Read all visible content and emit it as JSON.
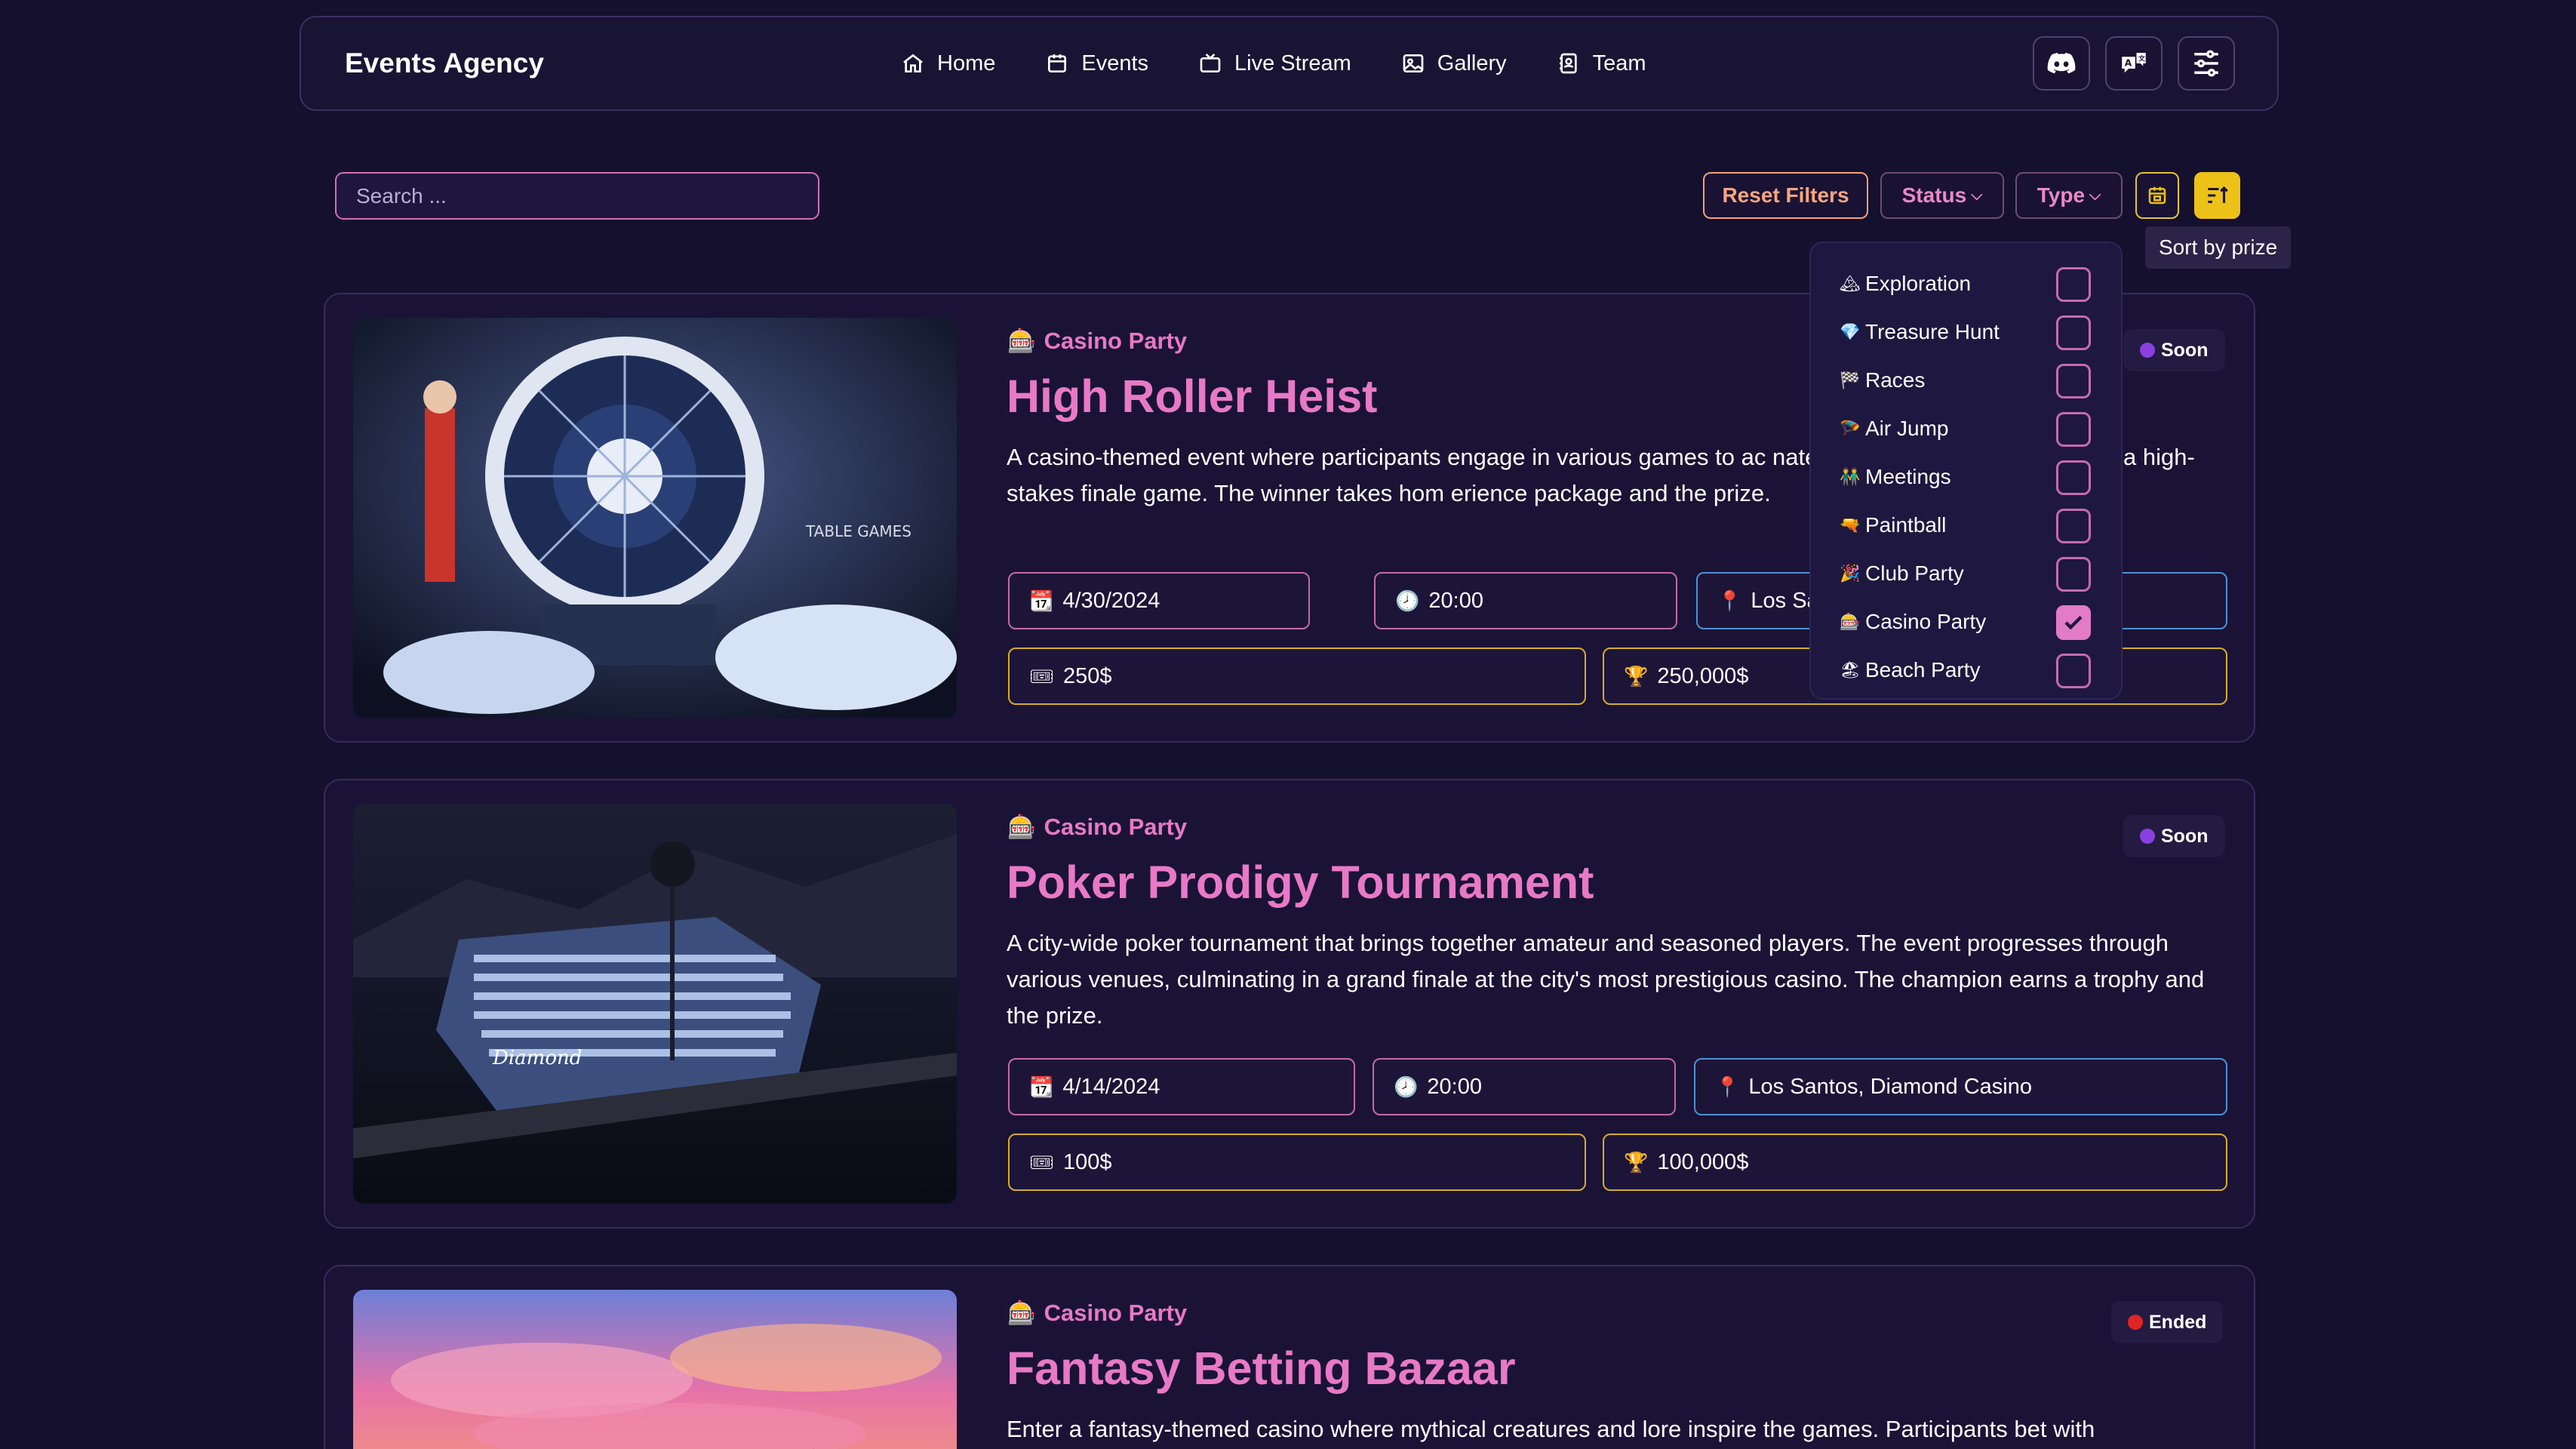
{
  "nav": {
    "brand": "Events Agency",
    "links": [
      {
        "label": "Home",
        "icon": "home-icon"
      },
      {
        "label": "Events",
        "icon": "calendar-icon"
      },
      {
        "label": "Live Stream",
        "icon": "tv-icon"
      },
      {
        "label": "Gallery",
        "icon": "image-icon"
      },
      {
        "label": "Team",
        "icon": "contacts-icon"
      }
    ],
    "icons": [
      "discord-icon",
      "translate-icon",
      "settings-sliders-icon"
    ]
  },
  "toolbar": {
    "search_placeholder": "Search ...",
    "reset_label": "Reset Filters",
    "status_label": "Status",
    "type_label": "Type",
    "sort_tooltip": "Sort by prize"
  },
  "type_filter": {
    "options": [
      {
        "emoji": "🏔",
        "label": "Exploration",
        "checked": false
      },
      {
        "emoji": "💎",
        "label": "Treasure Hunt",
        "checked": false
      },
      {
        "emoji": "🏁",
        "label": "Races",
        "checked": false
      },
      {
        "emoji": "🪂",
        "label": "Air Jump",
        "checked": false
      },
      {
        "emoji": "👬",
        "label": "Meetings",
        "checked": false
      },
      {
        "emoji": "🔫",
        "label": "Paintball",
        "checked": false
      },
      {
        "emoji": "🎉",
        "label": "Club Party",
        "checked": false
      },
      {
        "emoji": "🎰",
        "label": "Casino Party",
        "checked": true
      },
      {
        "emoji": "🏖",
        "label": "Beach Party",
        "checked": false
      }
    ]
  },
  "events": [
    {
      "type_emoji": "🎰",
      "type": "Casino Party",
      "title": "High Roller Heist",
      "description": "A casino-themed event where participants engage in various games to ac nate goal of 'cracking the vault' in a high-stakes finale game. The winner takes hom erience package and the prize.",
      "status": "Soon",
      "status_color": "#8b3fe0",
      "date_emoji": "📆",
      "date": "4/30/2024",
      "time_emoji": "🕗",
      "time": "20:00",
      "location_emoji": "📍",
      "location": "Los Sa",
      "fee_emoji": "🎟",
      "fee": "250$",
      "prize_emoji": "🏆",
      "prize": "250,000$"
    },
    {
      "type_emoji": "🎰",
      "type": "Casino Party",
      "title": "Poker Prodigy Tournament",
      "description": "A city-wide poker tournament that brings together amateur and seasoned players. The event progresses through various venues, culminating in a grand finale at the city's most prestigious casino. The champion earns a trophy and the prize.",
      "status": "Soon",
      "status_color": "#8b3fe0",
      "date_emoji": "📆",
      "date": "4/14/2024",
      "time_emoji": "🕗",
      "time": "20:00",
      "location_emoji": "📍",
      "location": "Los Santos, Diamond Casino",
      "fee_emoji": "🎟",
      "fee": "100$",
      "prize_emoji": "🏆",
      "prize": "100,000$"
    },
    {
      "type_emoji": "🎰",
      "type": "Casino Party",
      "title": "Fantasy Betting Bazaar",
      "description": "Enter a fantasy-themed casino where mythical creatures and lore inspire the games. Participants bet with",
      "status": "Ended",
      "status_color": "#e02424"
    }
  ],
  "colors": {
    "background": "#15102e",
    "accent_pink": "#e879c6",
    "accent_gold": "#ecc218",
    "reset_orange": "#f7a681"
  }
}
